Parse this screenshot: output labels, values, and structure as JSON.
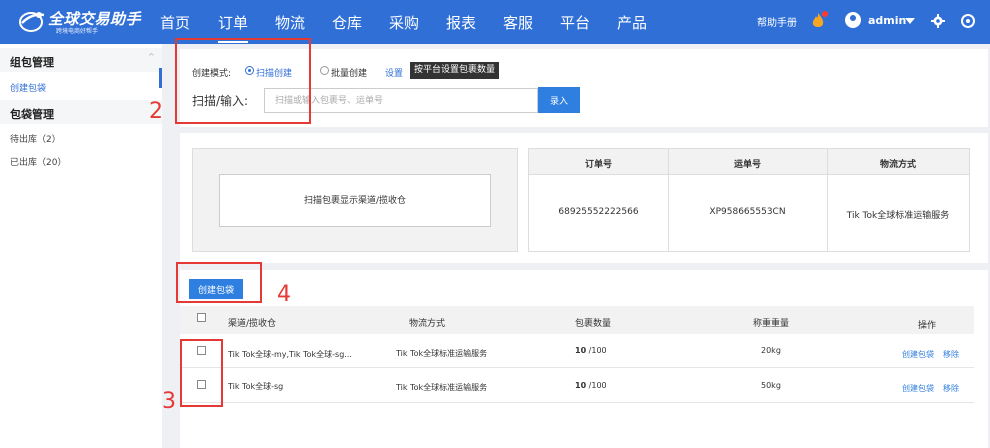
{
  "brand": {
    "name": "全球交易助手",
    "tagline": "跨境电商好帮手"
  },
  "nav": {
    "items": [
      {
        "label": "首页"
      },
      {
        "label": "订单"
      },
      {
        "label": "物流"
      },
      {
        "label": "仓库"
      },
      {
        "label": "采购"
      },
      {
        "label": "报表"
      },
      {
        "label": "客服"
      },
      {
        "label": "平台"
      },
      {
        "label": "产品"
      }
    ],
    "active_index": 1,
    "help": "帮助手册",
    "user": "admin"
  },
  "sidebar": {
    "group1": "组包管理",
    "create_bag": "创建包袋",
    "group2": "包袋管理",
    "pending": "待出库（2）",
    "shipped": "已出库（20）"
  },
  "form": {
    "mode_label": "创建模式:",
    "mode_scan": "扫描创建",
    "mode_batch": "批量创建",
    "settings": "设置",
    "tooltip": "按平台设置包裹数量",
    "scan_label": "扫描/输入:",
    "scan_placeholder": "扫描或输入包裹号、运单号",
    "submit": "录入"
  },
  "scan_hint": "扫描包裹显示渠道/揽收仓",
  "info": {
    "headers": [
      "订单号",
      "运单号",
      "物流方式"
    ],
    "values": [
      "68925552222566",
      "XP958665553CN",
      "Tik Tok全球标准运输服务"
    ]
  },
  "create_bag_button": "创建包袋",
  "bags": {
    "headers": [
      "渠道/揽收仓",
      "物流方式",
      "包裹数量",
      "称重重量",
      "操作"
    ],
    "rows": [
      {
        "channel": "Tik Tok全球-my,Tik Tok全球-sg...",
        "method": "Tik Tok全球标准运输服务",
        "count": "10",
        "total": " /100",
        "weight": "20kg",
        "action1": "创建包袋",
        "action2": "移除"
      },
      {
        "channel": "Tik Tok全球-sg",
        "method": "Tik Tok全球标准运输服务",
        "count": "10",
        "total": " /100",
        "weight": "50kg",
        "action1": "创建包袋",
        "action2": "移除"
      }
    ]
  },
  "annotations": [
    "2",
    "3",
    "4"
  ]
}
